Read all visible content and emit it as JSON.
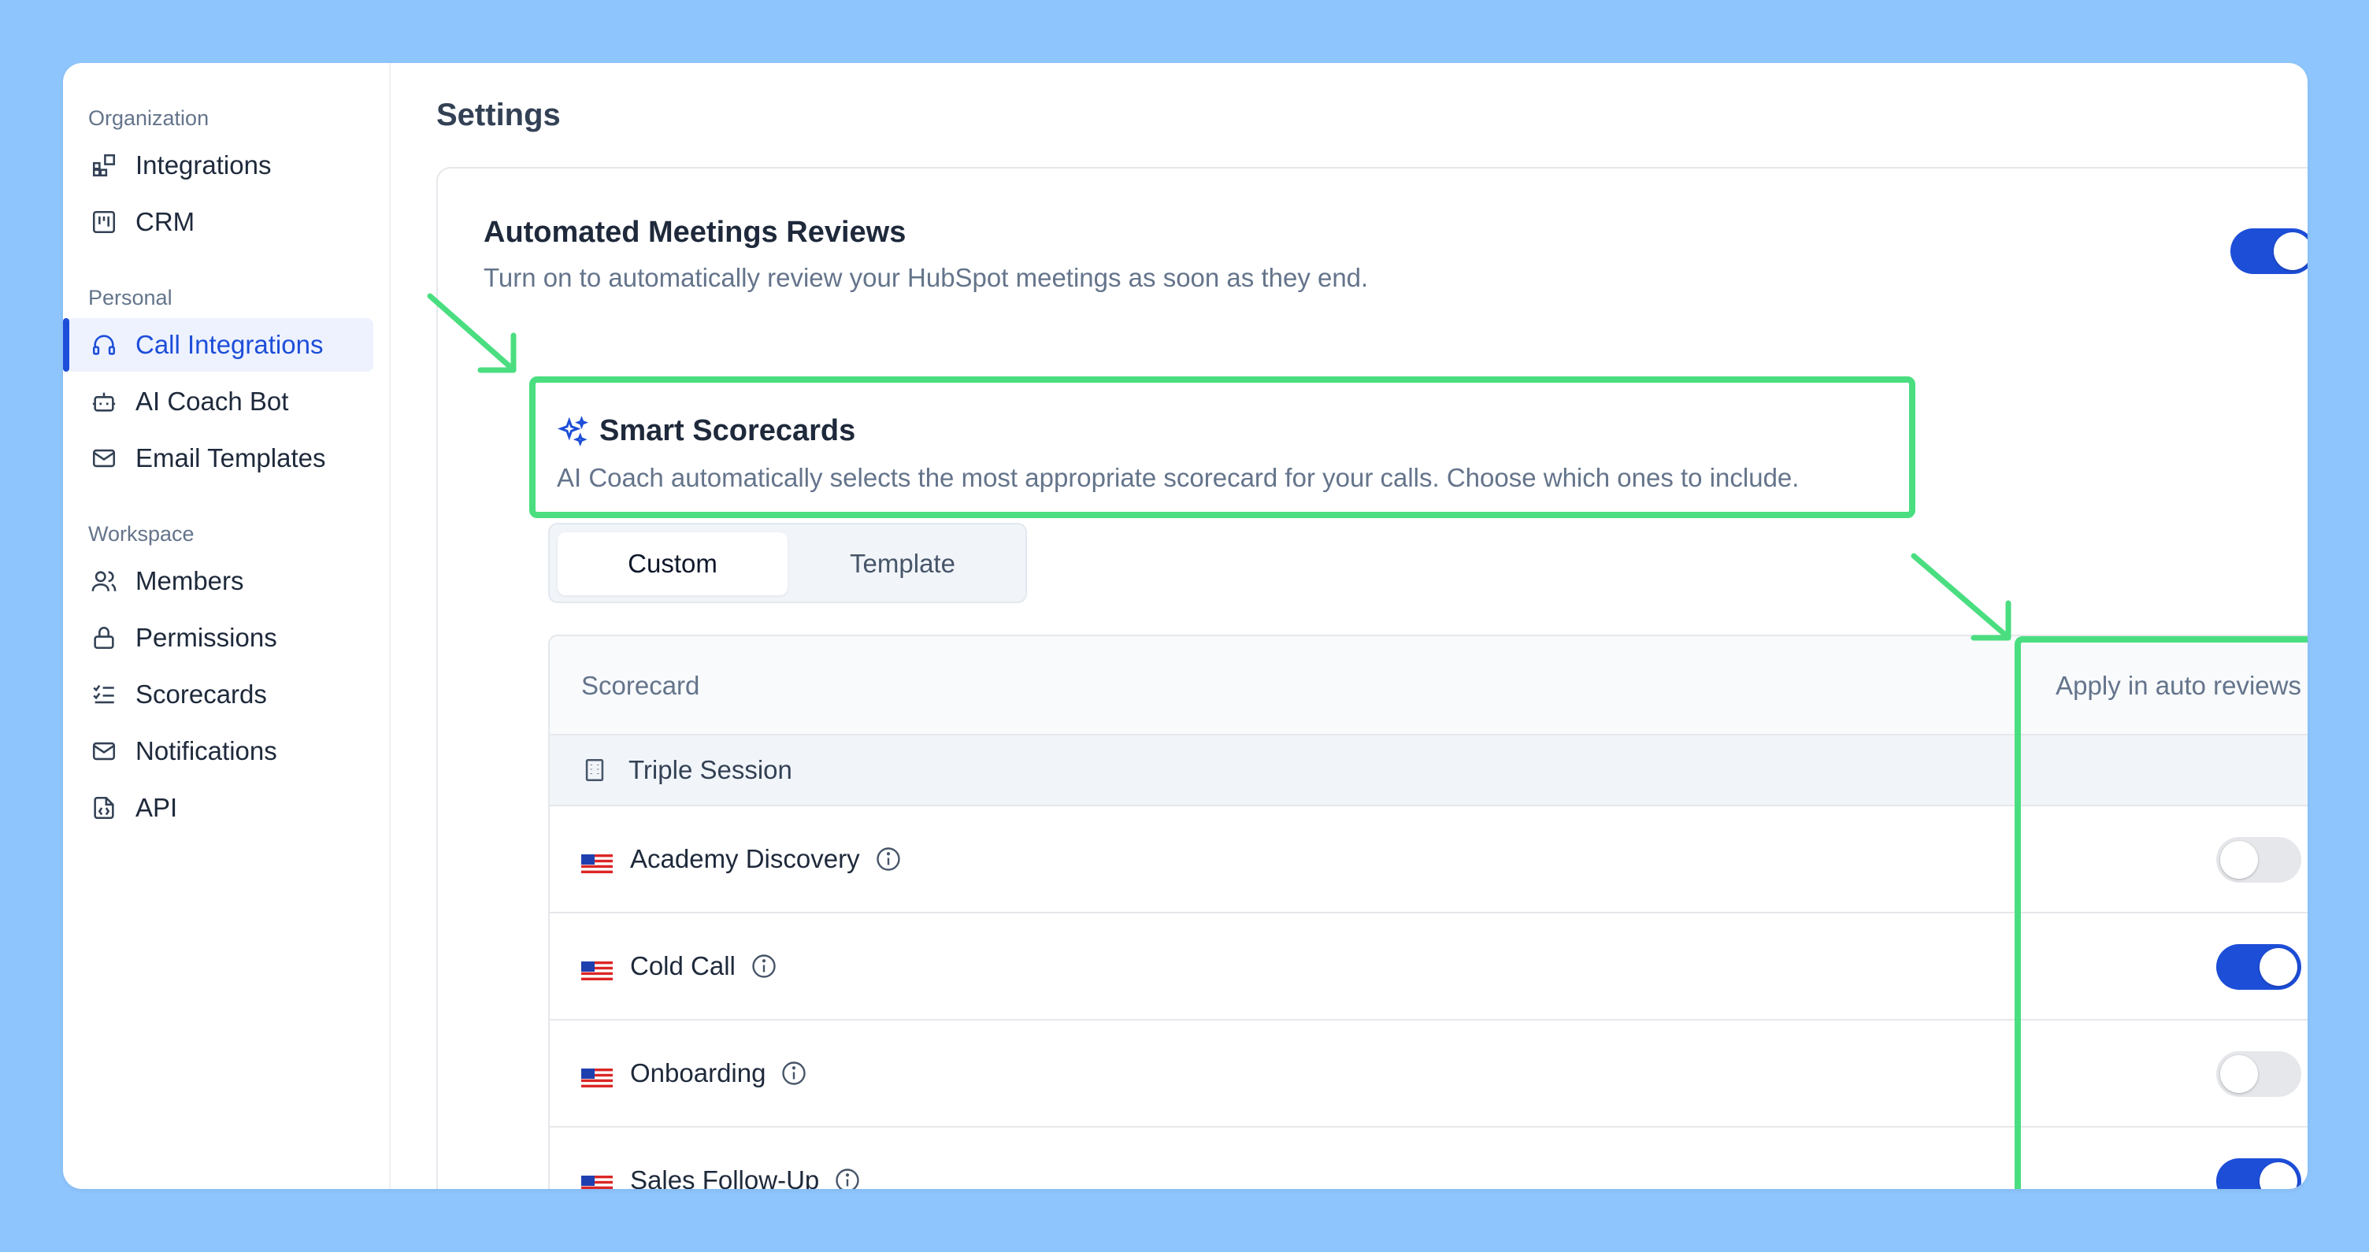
{
  "sidebar": {
    "sections": [
      {
        "label": "Organization",
        "items": [
          {
            "label": "Integrations",
            "icon": "grid-plus-icon"
          },
          {
            "label": "CRM",
            "icon": "kanban-icon"
          }
        ]
      },
      {
        "label": "Personal",
        "items": [
          {
            "label": "Call Integrations",
            "icon": "headset-icon",
            "active": true
          },
          {
            "label": "AI Coach Bot",
            "icon": "bot-icon"
          },
          {
            "label": "Email Templates",
            "icon": "mail-icon"
          }
        ]
      },
      {
        "label": "Workspace",
        "items": [
          {
            "label": "Members",
            "icon": "users-icon"
          },
          {
            "label": "Permissions",
            "icon": "lock-icon"
          },
          {
            "label": "Scorecards",
            "icon": "checklist-icon"
          },
          {
            "label": "Notifications",
            "icon": "mail-icon"
          },
          {
            "label": "API",
            "icon": "file-code-icon"
          }
        ]
      }
    ]
  },
  "page": {
    "title": "Settings"
  },
  "automated_reviews": {
    "title": "Automated Meetings Reviews",
    "description": "Turn on to automatically review your HubSpot meetings as soon as they end.",
    "enabled": true
  },
  "smart_scorecards": {
    "title": "Smart Scorecards",
    "description": "AI Coach automatically selects the most appropriate scorecard for your calls. Choose which ones to include.",
    "icon": "sparkles-icon"
  },
  "tabs": [
    {
      "label": "Custom",
      "active": true
    },
    {
      "label": "Template",
      "active": false
    }
  ],
  "table": {
    "headers": {
      "scorecard": "Scorecard",
      "apply": "Apply in auto reviews"
    },
    "group": {
      "label": "Triple Session",
      "icon": "building-icon"
    },
    "rows": [
      {
        "label": "Academy Discovery",
        "enabled": false
      },
      {
        "label": "Cold Call",
        "enabled": true
      },
      {
        "label": "Onboarding",
        "enabled": false
      },
      {
        "label": "Sales Follow-Up",
        "enabled": true
      }
    ]
  },
  "colors": {
    "accent": "#1d4ed8",
    "highlight": "#4ade80",
    "background": "#8ec5fc"
  }
}
